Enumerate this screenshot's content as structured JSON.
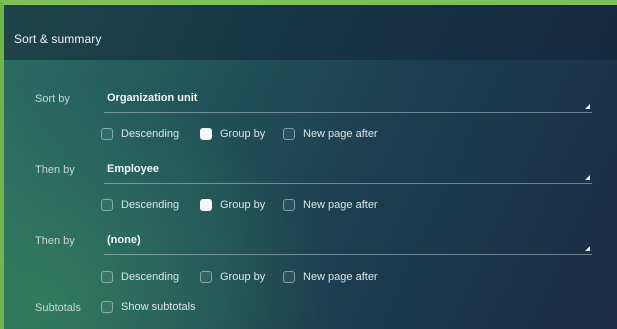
{
  "panel": {
    "title": "Sort & summary"
  },
  "rows": [
    {
      "label": "Sort by",
      "value": "Organization unit",
      "options": {
        "descending": {
          "label": "Descending",
          "checked": false
        },
        "group_by": {
          "label": "Group by",
          "checked": true
        },
        "new_page_after": {
          "label": "New page after",
          "checked": false
        }
      }
    },
    {
      "label": "Then by",
      "value": "Employee",
      "options": {
        "descending": {
          "label": "Descending",
          "checked": false
        },
        "group_by": {
          "label": "Group by",
          "checked": true
        },
        "new_page_after": {
          "label": "New page after",
          "checked": false
        }
      }
    },
    {
      "label": "Then by",
      "value": "(none)",
      "options": {
        "descending": {
          "label": "Descending",
          "checked": false
        },
        "group_by": {
          "label": "Group by",
          "checked": false
        },
        "new_page_after": {
          "label": "New page after",
          "checked": false
        }
      }
    }
  ],
  "subtotals": {
    "label": "Subtotals",
    "option": {
      "label": "Show subtotals",
      "checked": false
    }
  },
  "colors": {
    "accent_border": "#7ec15a",
    "panel_dark": "#1b2c44",
    "panel_teal": "#2c6f62",
    "checkbox_checked": "#f4f6f7"
  },
  "icons": {
    "select_caret": "caret-down-right-icon"
  }
}
